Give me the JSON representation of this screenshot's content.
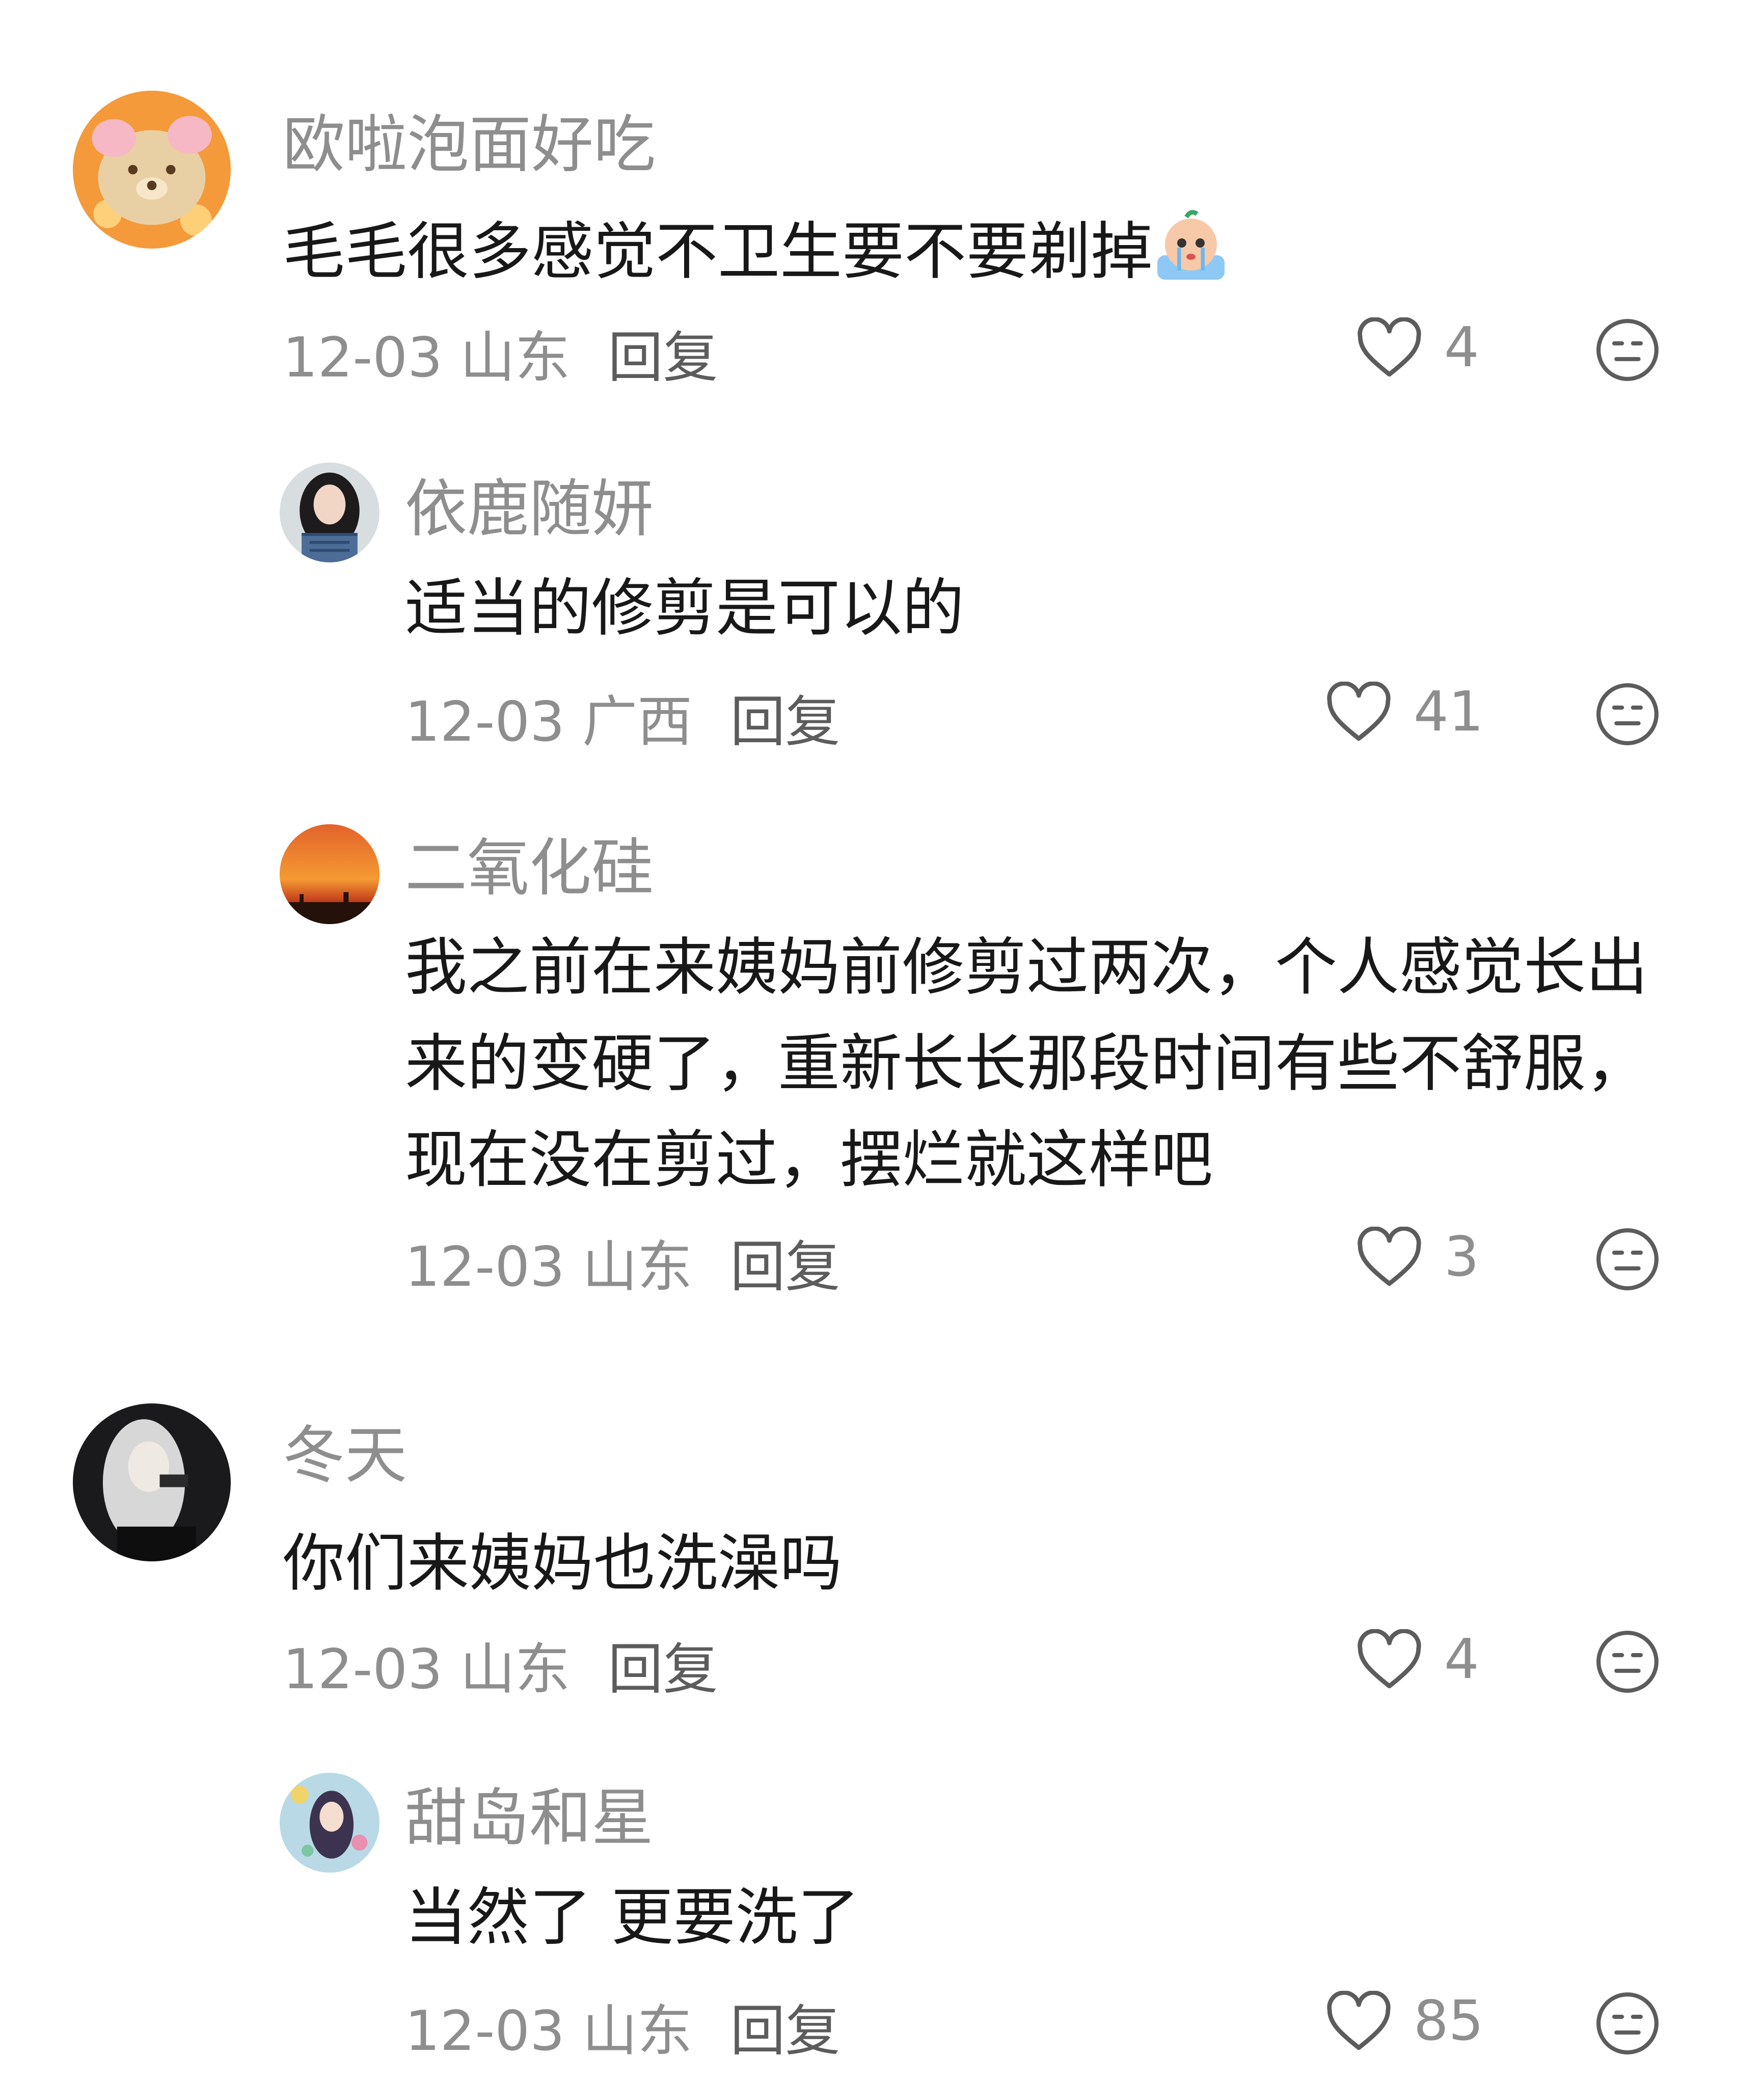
{
  "comments": [
    {
      "name": "欧啦泡面好吃",
      "text": "毛毛很多感觉不卫生要不要剃掉",
      "emoji": "crying-emoji",
      "date": "12-03",
      "location": "山东",
      "reply": "回复",
      "likes": "4"
    },
    {
      "name": "依鹿随妍",
      "text": "适当的修剪是可以的",
      "date": "12-03",
      "location": "广西",
      "reply": "回复",
      "likes": "41"
    },
    {
      "name": "二氧化硅",
      "text": "我之前在来姨妈前修剪过两次，个人感觉长出来的变硬了，重新长长那段时间有些不舒服，现在没在剪过，摆烂就这样吧",
      "date": "12-03",
      "location": "山东",
      "reply": "回复",
      "likes": "3"
    },
    {
      "name": "冬天",
      "text": "你们来姨妈也洗澡吗",
      "date": "12-03",
      "location": "山东",
      "reply": "回复",
      "likes": "4"
    },
    {
      "name": "甜岛和星",
      "text": "当然了 更要洗了",
      "date": "12-03",
      "location": "山东",
      "reply": "回复",
      "likes": "85"
    }
  ],
  "icons": {
    "like": "heart-outline-icon",
    "dislike": "neutral-face-icon"
  },
  "colors": {
    "secondary_text": "#8e8e8e",
    "primary_text": "#181818",
    "icon": "#5c5c5c"
  }
}
